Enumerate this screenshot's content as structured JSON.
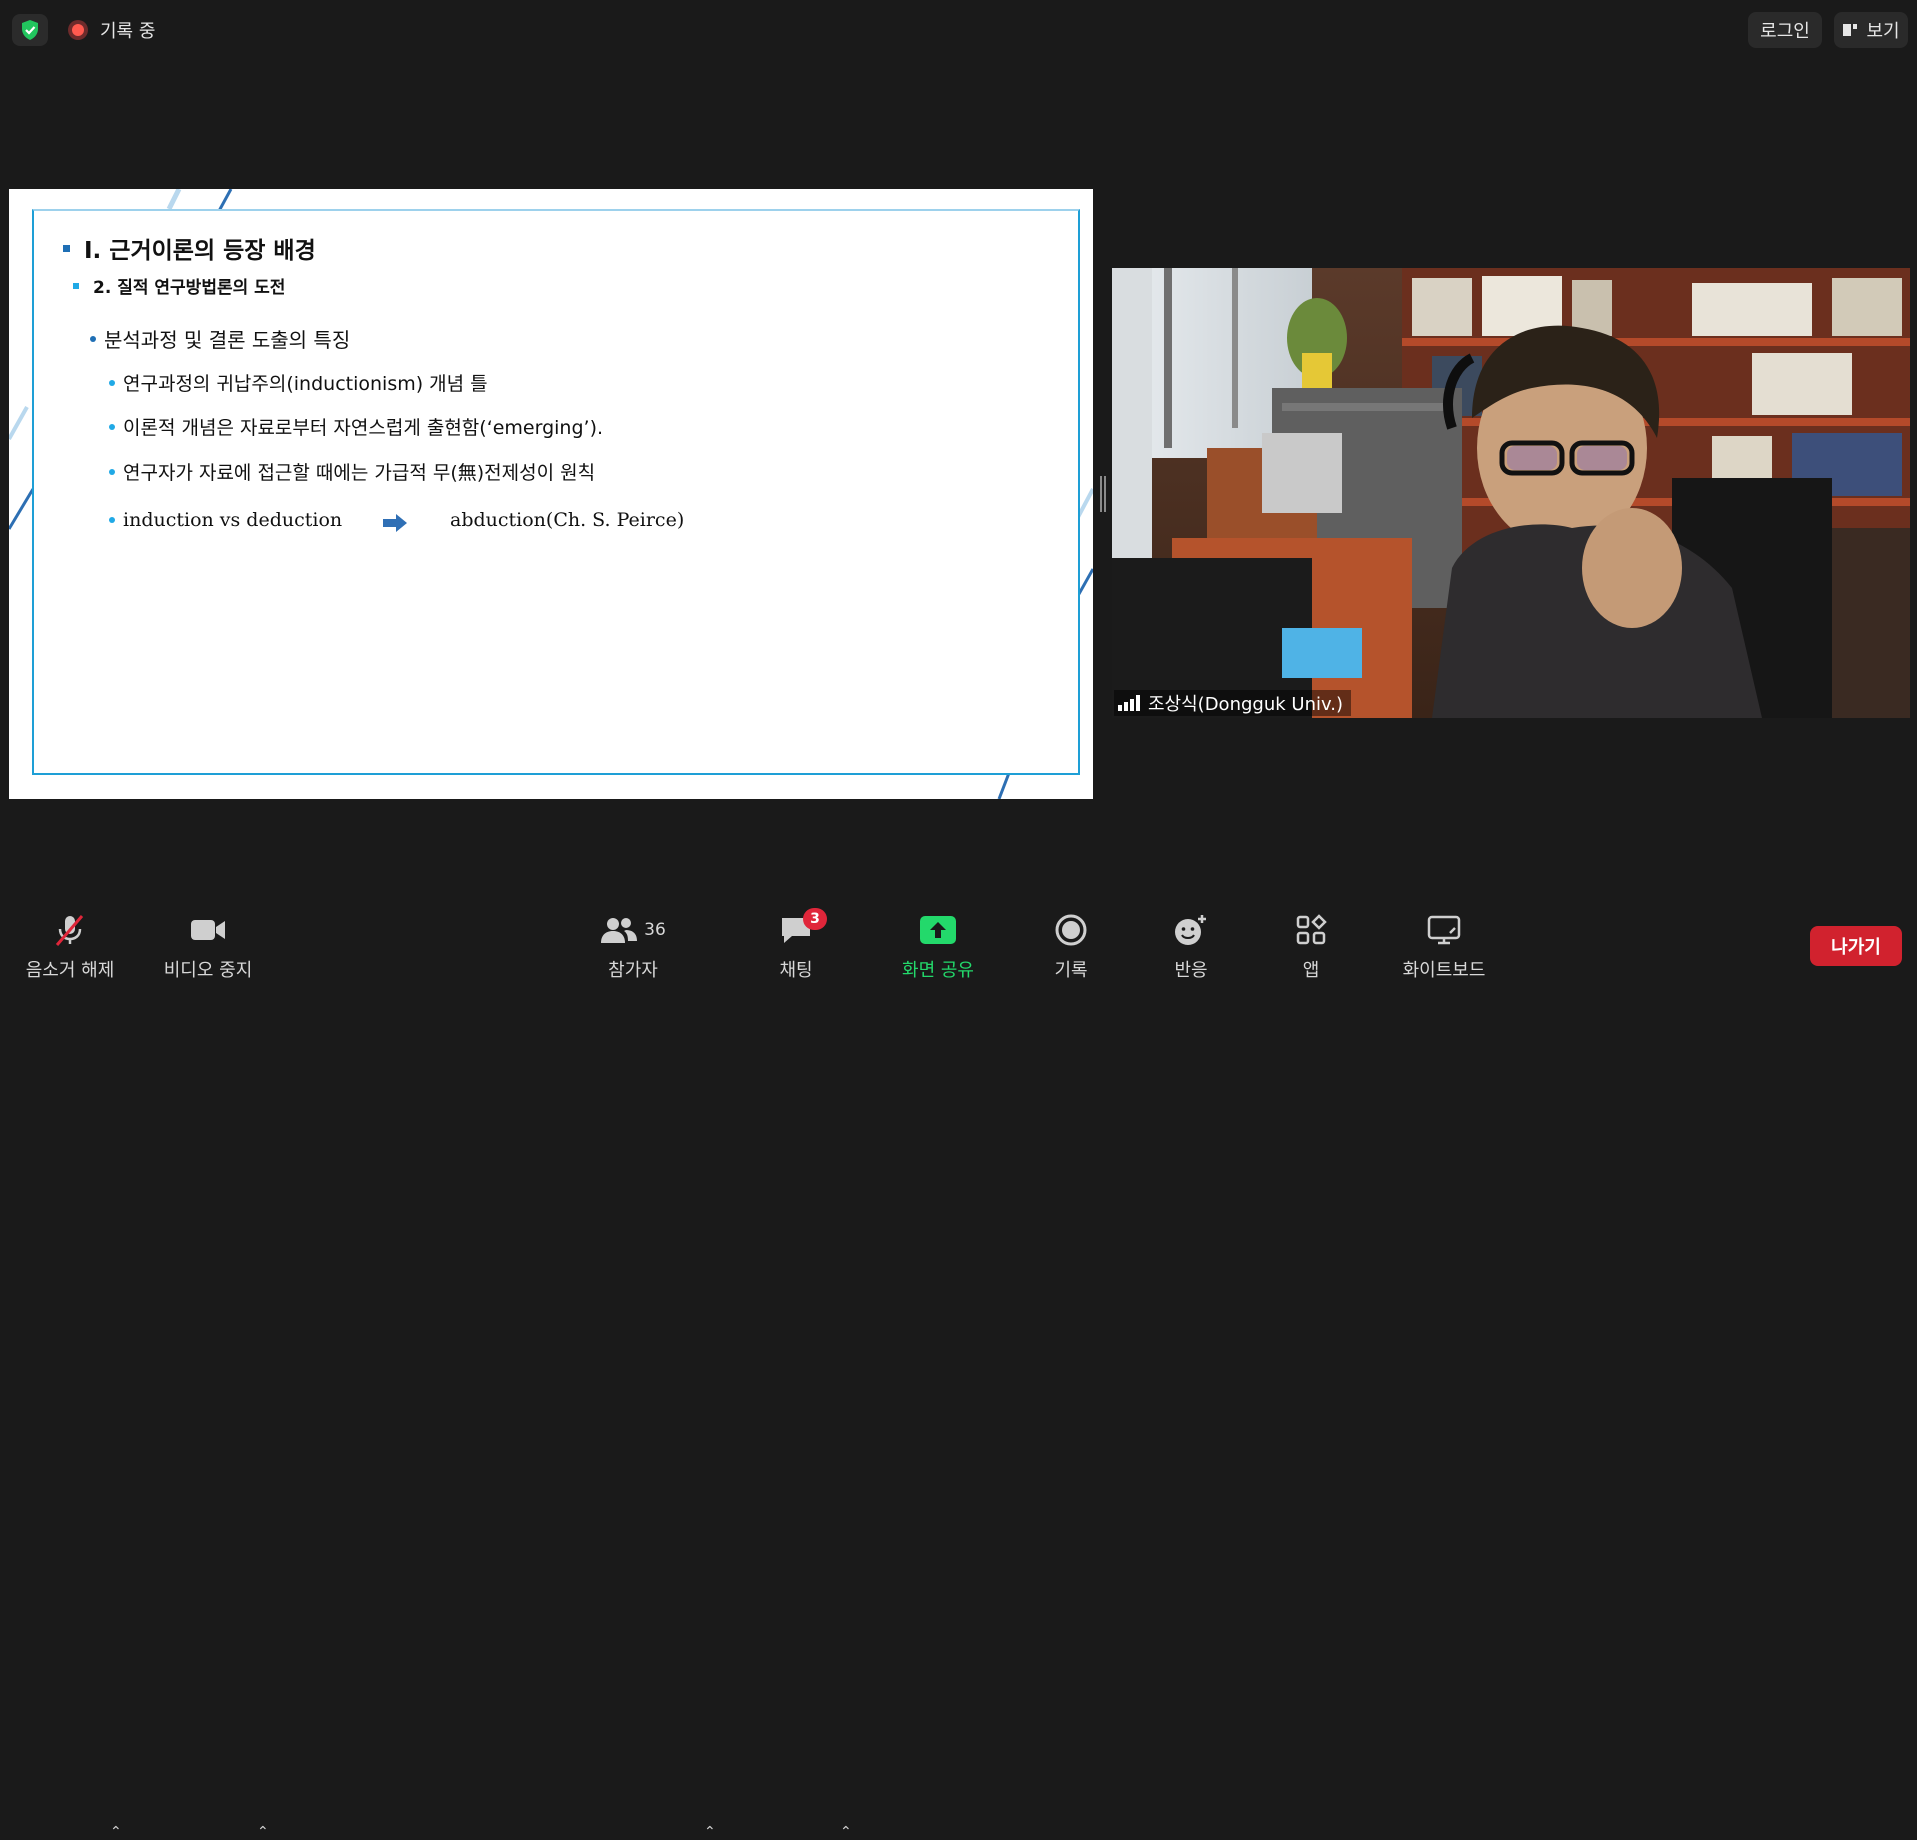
{
  "topbar": {
    "recording_label": "기록 중",
    "login_label": "로그인",
    "view_label": "보기"
  },
  "slide": {
    "title": "I. 근거이론의 등장 배경",
    "subtitle": "2. 질적 연구방법론의 도전",
    "level1": "분석과정 및 결론 도출의 특징",
    "bullets": [
      "연구과정의 귀납주의(inductionism) 개념 틀",
      "이론적 개념은 자료로부터 자연스럽게 출현함(‘emerging’).",
      "연구자가 자료에 접근할 때에는 가급적 무(無)전제성이 원칙",
      "induction vs deduction"
    ],
    "abduction": "abduction(Ch. S. Peirce)"
  },
  "video": {
    "participant_name": "조상식(Dongguk Univ.)"
  },
  "toolbar": {
    "unmute_label": "음소거 해제",
    "video_label": "비디오 중지",
    "participants_label": "참가자",
    "participants_count": "36",
    "chat_label": "채팅",
    "chat_badge": "3",
    "share_label": "화면 공유",
    "record_label": "기록",
    "reactions_label": "반응",
    "apps_label": "앱",
    "whiteboard_label": "화이트보드",
    "leave_label": "나가기"
  },
  "colors": {
    "share_green": "#23d96b",
    "leave_red": "#d1222e",
    "badge_red": "#e0263a",
    "slide_accent": "#1e9fd6"
  }
}
